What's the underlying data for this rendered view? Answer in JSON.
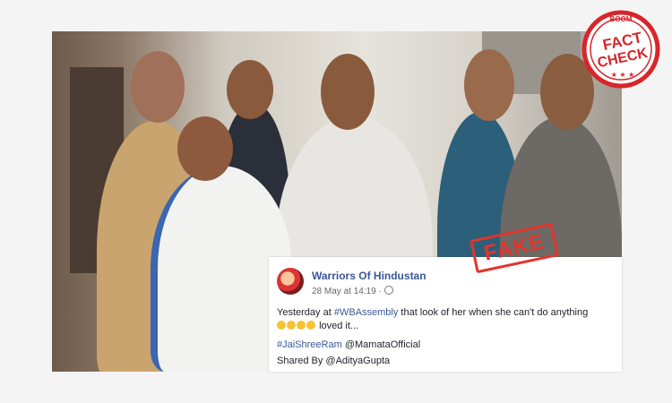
{
  "post": {
    "page_name": "Warriors Of Hindustan",
    "timestamp": "28 May at 14:19 ·",
    "text_line1": "Yesterday at",
    "hashtag1": "#WBAssembly",
    "text_line1_end": "that look of her when she can't do anything",
    "text_line2_end": "loved it...",
    "hashtag2": "#JaiShreeRam",
    "mention": "@MamataOfficial",
    "shared_by": "Shared By @AdityaGupta"
  },
  "stamp": {
    "fake_label": "FAKE"
  },
  "badge": {
    "boom_label": "BOOM",
    "fact_label": "FACT",
    "check_label": "CHECK",
    "stars": "★ ★ ★"
  },
  "colors": {
    "stamp_red": "#e2342b",
    "link_blue": "#385898"
  }
}
